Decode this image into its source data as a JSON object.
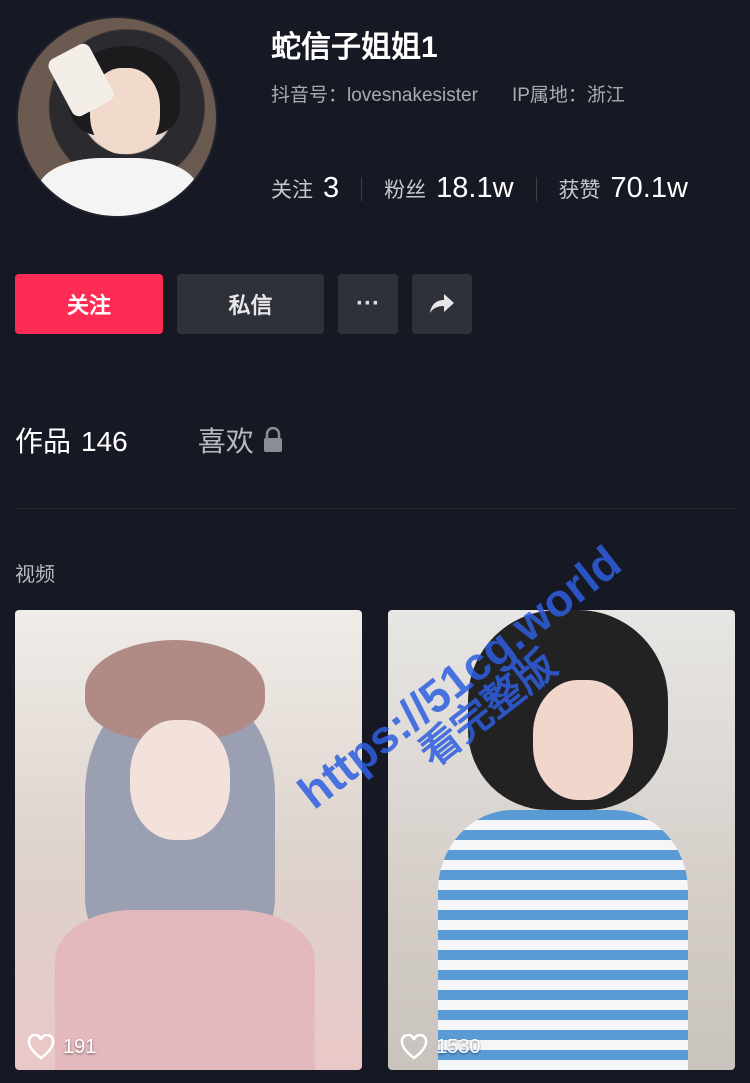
{
  "profile": {
    "name": "蛇信子姐姐1",
    "douyin_id": "抖音号：lovesnakesister",
    "ip": "IP属地：浙江"
  },
  "stats": {
    "following_label": "关注",
    "following_value": "3",
    "fans_label": "粉丝",
    "fans_value": "18.1w",
    "likes_label": "获赞",
    "likes_value": "70.1w"
  },
  "actions": {
    "follow": "关注",
    "message": "私信",
    "more": "···"
  },
  "tabs": {
    "works_label": "作品",
    "works_count": "146",
    "likes_label": "喜欢"
  },
  "section_title": "视频",
  "videos": [
    {
      "likes": "191"
    },
    {
      "likes": "1530"
    }
  ],
  "watermark": {
    "line1": "https://51cg.world",
    "line2": "看完整版"
  },
  "colors": {
    "background": "#161823",
    "accent": "#fe2c55",
    "button_dark": "#2f313a",
    "watermark": "#2e5fe0"
  }
}
